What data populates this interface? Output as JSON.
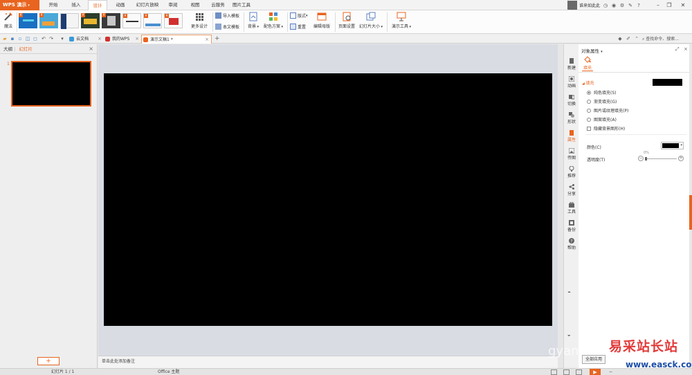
{
  "app": {
    "name": "WPS 演示"
  },
  "menu": {
    "tabs": [
      "开始",
      "插入",
      "设计",
      "动画",
      "幻灯片放映",
      "审阅",
      "视图",
      "云服务",
      "图片工具"
    ],
    "active": "设计"
  },
  "user": {
    "name": "谁来如此此"
  },
  "ribbon": {
    "magic": "魔法",
    "more_design": "更多设计",
    "import_template": "导入模板",
    "this_template": "本文模板",
    "background": "背景",
    "color_scheme": "配色方案",
    "layout": "版式",
    "reset": "重置",
    "edit_master": "编辑母版",
    "page_setup": "页面设置",
    "slide_size": "幻灯片大小",
    "present_tools": "演示工具"
  },
  "tabs": {
    "items": [
      {
        "label": "云文档"
      },
      {
        "label": "我的WPS"
      },
      {
        "label": "演示文稿1 *"
      }
    ],
    "add": "+",
    "cmd_search": "查找命令、搜索..."
  },
  "left_panel": {
    "outline": "大纲",
    "slides": "幻灯片",
    "slide_number": "1",
    "add": "+"
  },
  "notes": {
    "placeholder": "单击此处添加备注"
  },
  "side_bar": {
    "items": [
      "新建",
      "动画",
      "切换",
      "形状",
      "属性",
      "传图",
      "推荐",
      "分享",
      "工具",
      "备份",
      "帮助"
    ]
  },
  "property_panel": {
    "title": "对象属性",
    "tab": "填充",
    "fill_section": "填充",
    "options": [
      "纯色填充(S)",
      "渐变填充(G)",
      "图片或纹理填充(P)",
      "图案填充(A)"
    ],
    "hide_bg": "隐藏背景图形(H)",
    "color_label": "颜色(C)",
    "transparency_label": "透明度(T)",
    "transparency_value": "0%",
    "apply_all": "全部应用"
  },
  "status": {
    "slide": "幻灯片 1 / 1",
    "theme": "Office 主题"
  },
  "watermark": {
    "cn": "易采站长站",
    "url": "www.easck.com",
    "gy": "gyan"
  },
  "colors": {
    "accent": "#e8641f",
    "slide_bg": "#000000"
  }
}
